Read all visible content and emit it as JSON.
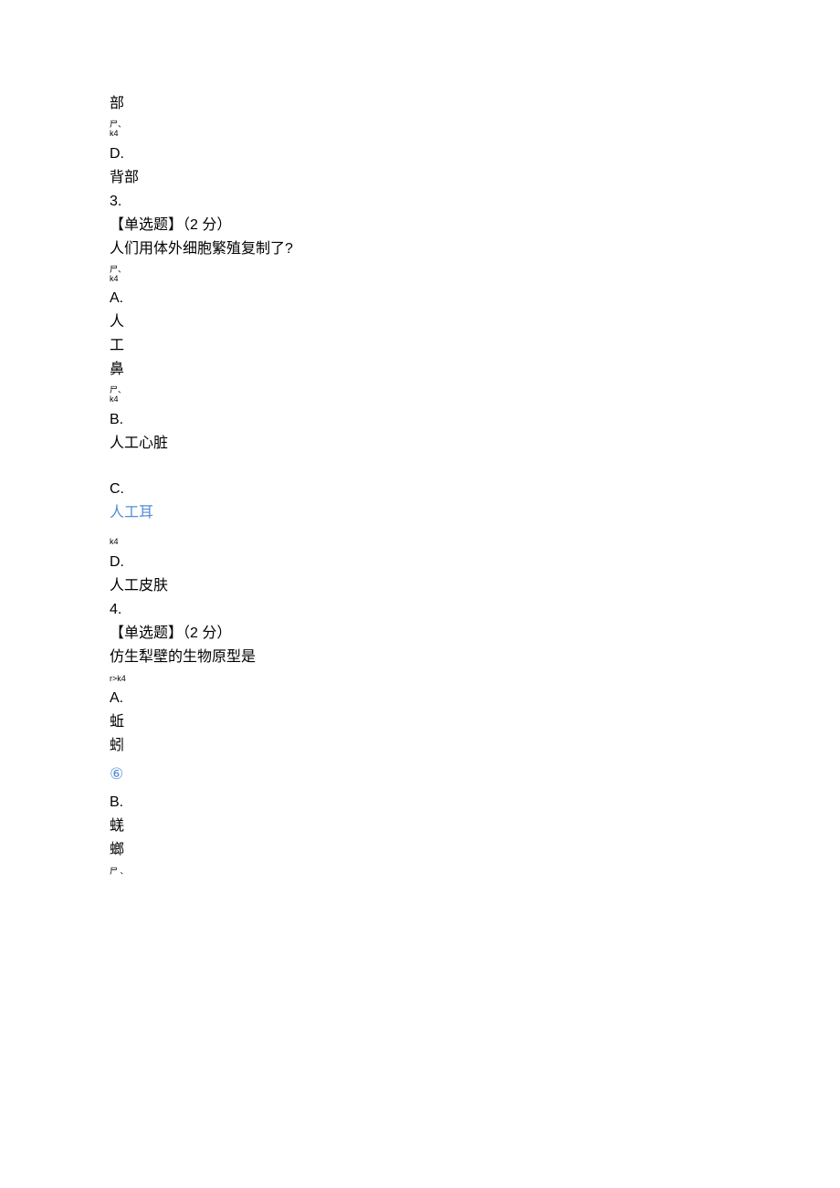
{
  "q2_partial": {
    "optC_char": "部",
    "optD_letter": "D.",
    "optD_text": "背部"
  },
  "q3": {
    "number": "3.",
    "tag": "【单选题】（2 分）",
    "stem": "人们用体外细胞繁殖复制了?",
    "optA_letter": "A.",
    "optA_l1": "人",
    "optA_l2": "工",
    "optA_l3": "鼻",
    "optB_letter": "B.",
    "optB_text": "人工心脏",
    "optC_letter": "C.",
    "optC_text": "人工耳",
    "optD_letter": "D.",
    "optD_text": "人工皮肤"
  },
  "q4": {
    "number": "4.",
    "tag": "【单选题】（2 分）",
    "stem": "仿生犁壁的生物原型是",
    "optA_letter": "A.",
    "optA_l1": "蚯",
    "optA_l2": "蚓",
    "circle": "⑥",
    "optB_letter": "B.",
    "optB_l1": "蜣",
    "optB_l2": "螂"
  },
  "markers": {
    "prime_top": "尸",
    "k4": "k4",
    "dot": "、",
    "r_k4": "r>k4"
  }
}
